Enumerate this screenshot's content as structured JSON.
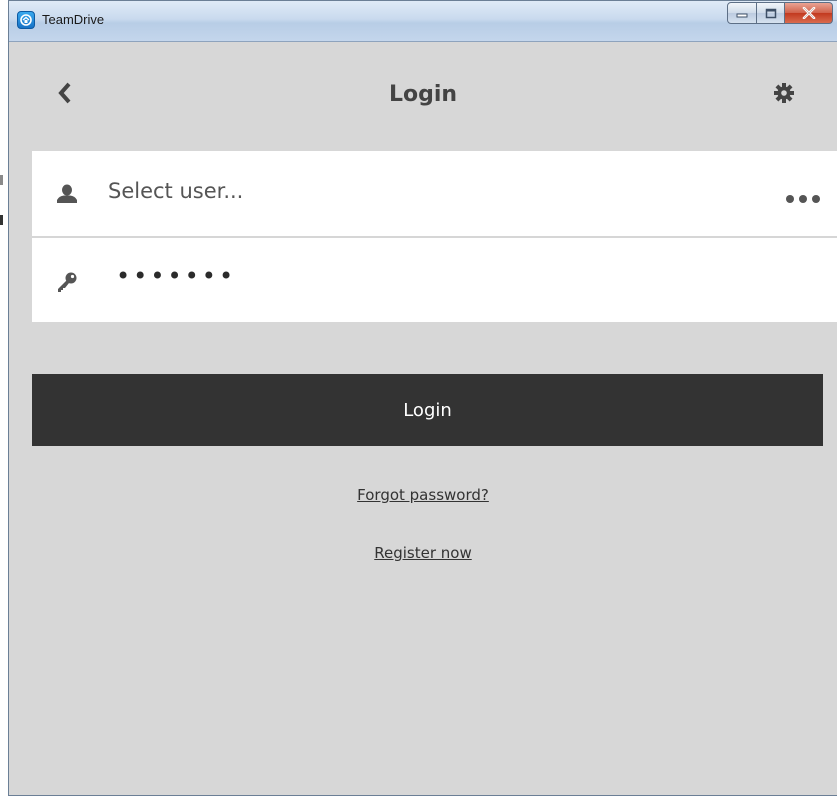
{
  "window": {
    "title": "TeamDrive"
  },
  "header": {
    "title": "Login"
  },
  "form": {
    "user_placeholder": "Select user...",
    "password_value": "•••••••"
  },
  "actions": {
    "login_label": "Login",
    "forgot_password": "Forgot password?",
    "register_now": "Register now"
  },
  "icons": {
    "app": "teamdrive-logo-icon",
    "back": "chevron-left-icon",
    "settings": "gear-icon",
    "user": "user-icon",
    "more": "more-dots-icon",
    "password": "key-icon"
  },
  "colors": {
    "background": "#d7d7d7",
    "card": "#ffffff",
    "button": "#333333",
    "button_text": "#ffffff",
    "header_text": "#444444"
  }
}
